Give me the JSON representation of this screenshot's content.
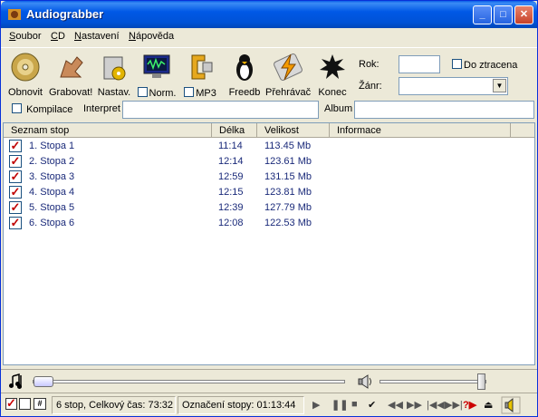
{
  "window": {
    "title": "Audiograbber"
  },
  "menu": [
    {
      "label": "Soubor"
    },
    {
      "label": "CD"
    },
    {
      "label": "Nastavení"
    },
    {
      "label": "Nápověda"
    }
  ],
  "toolbar": {
    "obnovit": "Obnovit",
    "grabovat": "Grabovat!",
    "nastav": "Nastav.",
    "norm": "Norm.",
    "mp3": "MP3",
    "freedb": "Freedb",
    "prehravac": "Přehrávač",
    "konec": "Konec",
    "rok_label": "Rok:",
    "rok_value": "",
    "do_ztracena": "Do ztracena",
    "zanr_label": "Žánr:",
    "zanr_value": ""
  },
  "infobar": {
    "kompilace": "Kompilace",
    "interpret_label": "Interpret",
    "interpret_value": "",
    "album_label": "Album",
    "album_value": ""
  },
  "list": {
    "columns": [
      "Seznam stop",
      "Délka",
      "Velikost",
      "Informace"
    ],
    "rows": [
      {
        "name": "1. Stopa  1",
        "length": "11:14",
        "size": "113.45 Mb",
        "info": "",
        "checked": true
      },
      {
        "name": "2. Stopa  2",
        "length": "12:14",
        "size": "123.61 Mb",
        "info": "",
        "checked": true
      },
      {
        "name": "3. Stopa  3",
        "length": "12:59",
        "size": "131.15 Mb",
        "info": "",
        "checked": true
      },
      {
        "name": "4. Stopa  4",
        "length": "12:15",
        "size": "123.81 Mb",
        "info": "",
        "checked": true
      },
      {
        "name": "5. Stopa  5",
        "length": "12:39",
        "size": "127.79 Mb",
        "info": "",
        "checked": true
      },
      {
        "name": "6. Stopa  6",
        "length": "12:08",
        "size": "122.53 Mb",
        "info": "",
        "checked": true
      }
    ]
  },
  "status": {
    "summary": "6 stop, Celkový čas: 73:32",
    "selection": "Označení stopy: 01:13:44"
  },
  "controls": {
    "position_fraction": 0.0,
    "volume_fraction": 1.0
  }
}
